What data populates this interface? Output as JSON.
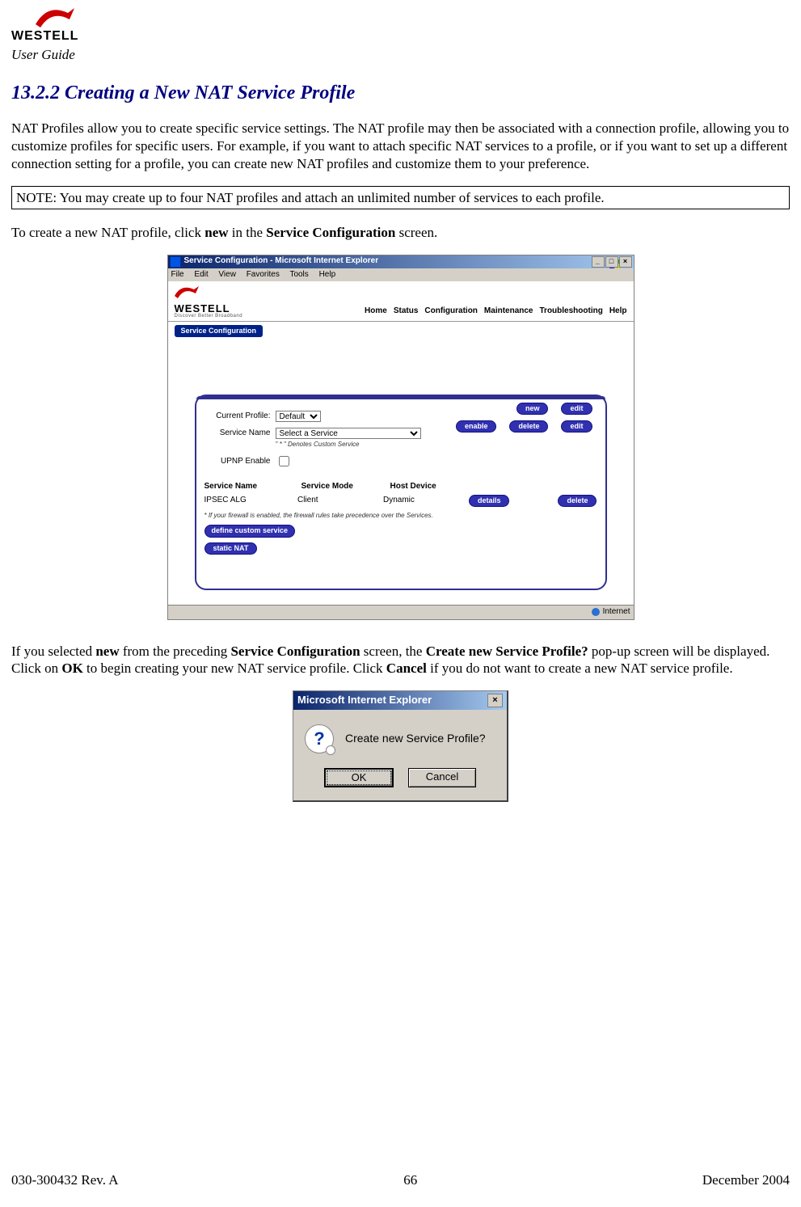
{
  "header": {
    "brand": "WESTELL",
    "doc_label": "User Guide"
  },
  "section": {
    "number": "13.2.2",
    "title": "Creating a New NAT Service Profile"
  },
  "paragraphs": {
    "intro": "NAT Profiles allow you to create specific service settings. The NAT profile may then be associated with a connection profile, allowing you to customize profiles for specific users. For example, if you want to attach specific NAT services to a profile, or if you want to set up a different connection setting for a profile, you can create new NAT profiles and customize them to your preference.",
    "note": "NOTE: You may create up to four NAT profiles and attach an unlimited number of services to each profile.",
    "instruction_pre": "To create a new NAT profile, click ",
    "instruction_bold1": "new",
    "instruction_mid": " in the ",
    "instruction_bold2": "Service Configuration",
    "instruction_post": " screen.",
    "after1_a": "If you selected ",
    "after1_b": "new",
    "after1_c": " from the preceding ",
    "after1_d": "Service Configuration",
    "after1_e": " screen, the ",
    "after1_f": "Create new Service Profile?",
    "after1_g": " pop-up screen will be displayed. Click on ",
    "after1_h": "OK",
    "after1_i": " to begin creating your new NAT service profile. Click ",
    "after1_j": "Cancel",
    "after1_k": " if you do not want to create a new NAT service profile."
  },
  "ie": {
    "title": "Service Configuration - Microsoft Internet Explorer",
    "menu": [
      "File",
      "Edit",
      "View",
      "Favorites",
      "Tools",
      "Help"
    ],
    "brand": "WESTELL",
    "tagline": "Discover Better Broadband",
    "nav": [
      "Home",
      "Status",
      "Configuration",
      "Maintenance",
      "Troubleshooting",
      "Help"
    ],
    "tab": "Service Configuration",
    "labels": {
      "current_profile": "Current Profile:",
      "service_name": "Service Name",
      "upnp_enable": "UPNP Enable",
      "denotes": "\" * \" Denotes Custom Service"
    },
    "values": {
      "current_profile": "Default",
      "service_name": "Select a Service"
    },
    "buttons": {
      "new": "new",
      "edit": "edit",
      "enable": "enable",
      "delete": "delete",
      "details": "details",
      "define_custom": "define custom service",
      "static_nat": "static NAT"
    },
    "table": {
      "headers": [
        "Service Name",
        "Service Mode",
        "Host Device"
      ],
      "row": [
        "IPSEC ALG",
        "Client",
        "Dynamic"
      ]
    },
    "footnote": "* If your firewall is enabled, the firewall rules take precedence over the Services.",
    "status": "Internet"
  },
  "dialog": {
    "title": "Microsoft Internet Explorer",
    "message": "Create new Service Profile?",
    "ok": "OK",
    "cancel": "Cancel"
  },
  "footer": {
    "left": "030-300432 Rev. A",
    "center": "66",
    "right": "December 2004"
  }
}
